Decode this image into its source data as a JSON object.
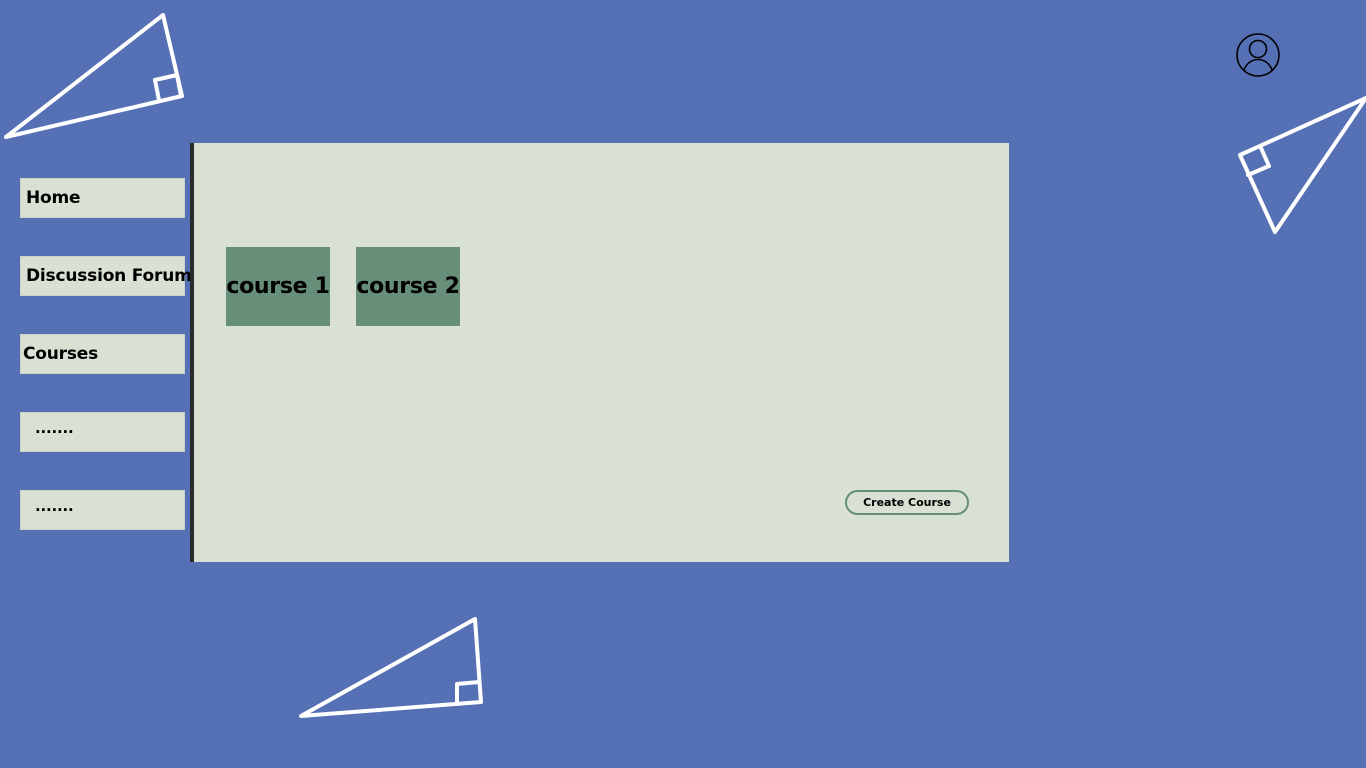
{
  "theme": {
    "background": "#5670b5",
    "panel": "#d9e1d4",
    "card": "#678e78",
    "accent": "#678e78"
  },
  "header": {
    "profile_icon": "user-circle-icon"
  },
  "sidebar": {
    "items": [
      {
        "label": "Home"
      },
      {
        "label": "Discussion Forum"
      },
      {
        "label": "Courses"
      },
      {
        "label": "·······"
      },
      {
        "label": "·······"
      }
    ]
  },
  "main": {
    "courses": [
      {
        "label": "course 1"
      },
      {
        "label": "course 2"
      }
    ],
    "create_label": "Create Course"
  },
  "decorations": [
    "triangle-ruler-icon",
    "triangle-ruler-icon",
    "triangle-ruler-icon"
  ]
}
